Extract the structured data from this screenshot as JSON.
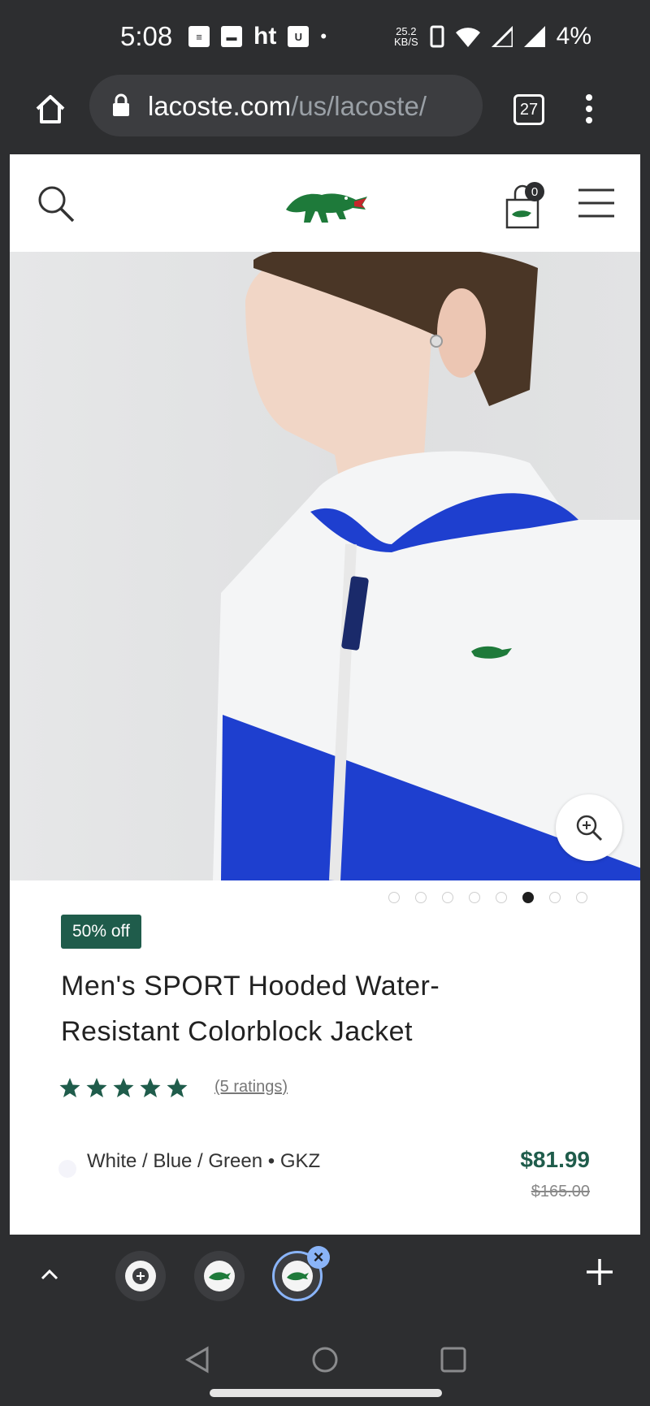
{
  "status_bar": {
    "time": "5:08",
    "app_icons": [
      "news-icon",
      "paytm-icon",
      "ht",
      "u-icon"
    ],
    "ht_label": "ht",
    "network_speed": "25.2",
    "network_unit": "KB/S",
    "battery": "4%"
  },
  "browser": {
    "url_domain": "lacoste.com",
    "url_path": "/us/lacoste/",
    "tab_count": "27"
  },
  "site": {
    "cart_count": "0",
    "brand_color": "#1f5c4b"
  },
  "gallery": {
    "image_count": 8,
    "active_index": 5
  },
  "product": {
    "discount_badge": "50% off",
    "title": "Men's SPORT Hooded Water-Resistant Colorblock Jacket",
    "rating": 5,
    "ratings_text": "(5 ratings)",
    "color_label": "White / Blue / Green • GKZ",
    "price": "$81.99",
    "original_price": "$165.00"
  },
  "tab_strip": {
    "tabs": [
      {
        "icon": "new-tab-icon"
      },
      {
        "icon": "lacoste-favicon"
      },
      {
        "icon": "lacoste-favicon",
        "active": true
      }
    ]
  }
}
